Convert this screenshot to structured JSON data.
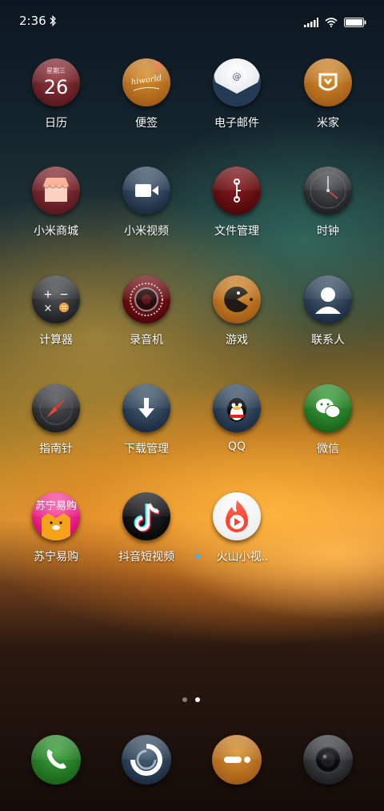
{
  "status_bar": {
    "time": "2:36",
    "bluetooth_icon": "bluetooth-icon",
    "signal_icon": "signal-icon",
    "wifi_icon": "wifi-icon",
    "battery_icon": "battery-icon"
  },
  "calendar": {
    "weekday": "星期三",
    "day": "26"
  },
  "notes_icon_text": "hiworld",
  "apps": [
    {
      "label": "日历",
      "icon": "calendar-icon"
    },
    {
      "label": "便签",
      "icon": "notes-icon"
    },
    {
      "label": "电子邮件",
      "icon": "email-icon"
    },
    {
      "label": "米家",
      "icon": "mijia-icon"
    },
    {
      "label": "小米商城",
      "icon": "store-icon"
    },
    {
      "label": "小米视频",
      "icon": "video-icon"
    },
    {
      "label": "文件管理",
      "icon": "file-manager-icon"
    },
    {
      "label": "时钟",
      "icon": "clock-icon"
    },
    {
      "label": "计算器",
      "icon": "calculator-icon"
    },
    {
      "label": "录音机",
      "icon": "recorder-icon"
    },
    {
      "label": "游戏",
      "icon": "game-icon"
    },
    {
      "label": "联系人",
      "icon": "contacts-icon"
    },
    {
      "label": "指南针",
      "icon": "compass-icon"
    },
    {
      "label": "下载管理",
      "icon": "download-icon"
    },
    {
      "label": "QQ",
      "icon": "qq-icon"
    },
    {
      "label": "微信",
      "icon": "wechat-icon"
    },
    {
      "label": "苏宁易购",
      "icon": "suning-icon"
    },
    {
      "label": "抖音短视频",
      "icon": "douyin-icon"
    },
    {
      "label": "火山小视..",
      "icon": "huoshan-icon"
    }
  ],
  "suning_icon_text": "苏宁易购",
  "page_indicator": {
    "pages": 2,
    "current": 2
  },
  "dock": [
    {
      "icon": "phone-icon"
    },
    {
      "icon": "messages-icon"
    },
    {
      "icon": "browser-icon"
    },
    {
      "icon": "camera-icon"
    }
  ],
  "colors": {
    "accent_new_dot": "#3fb0ff",
    "maroon": "#5e1c22",
    "orange": "#a9621a",
    "navy": "#1f3146"
  }
}
